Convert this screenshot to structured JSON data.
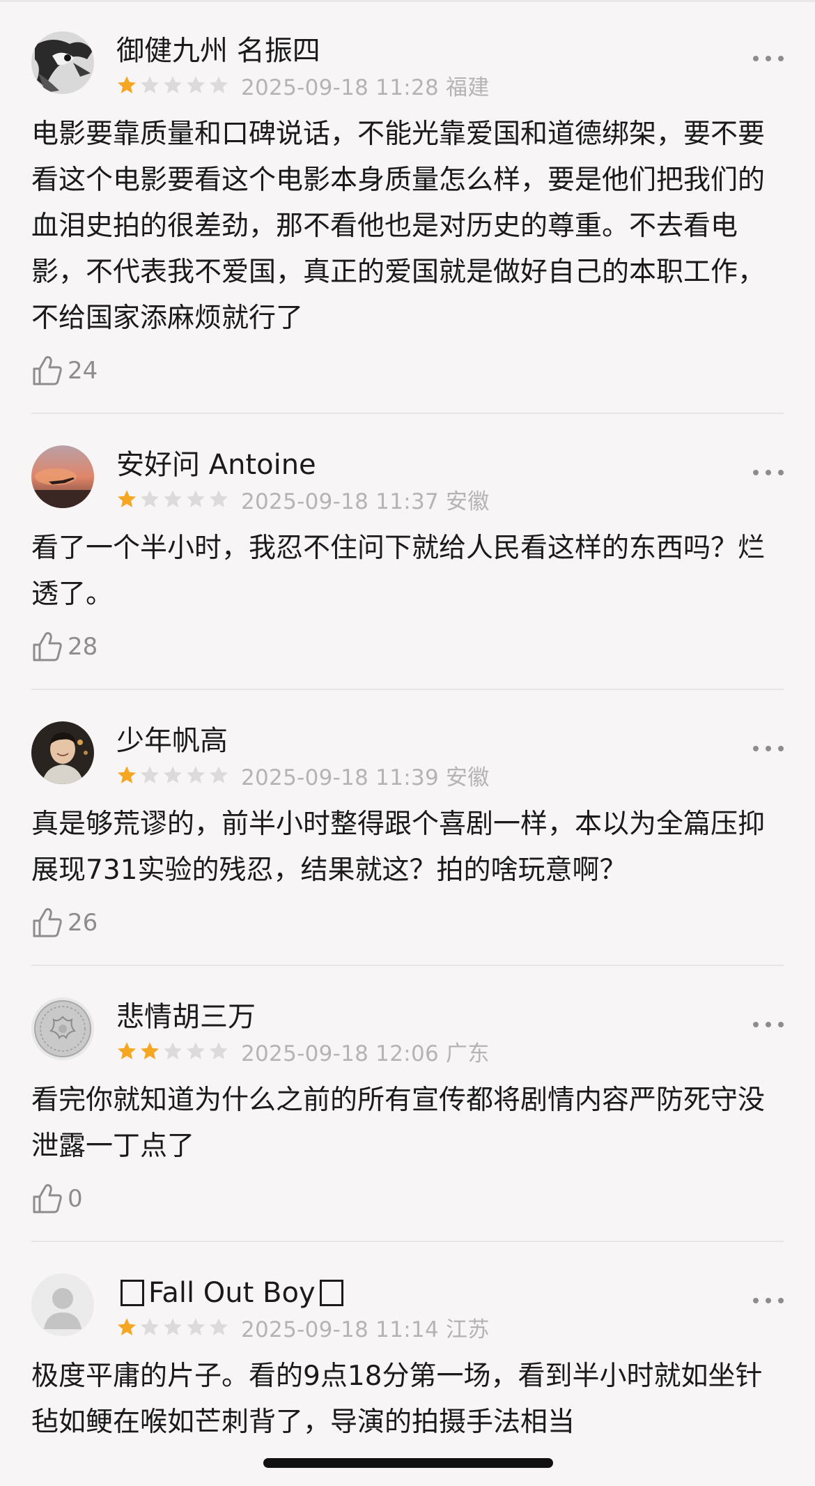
{
  "reviews": [
    {
      "username": "御健九州 名振四",
      "rating": 1,
      "date": "2025-09-18",
      "time": "11:28",
      "location": "福建",
      "content": "电影要靠质量和口碑说话，不能光靠爱国和道德绑架，要不要看这个电影要看这个电影本身质量怎么样，要是他们把我们的血泪史拍的很差劲，那不看他也是对历史的尊重。不去看电影，不代表我不爱国，真正的爱国就是做好自己的本职工作，不给国家添麻烦就行了",
      "likes": "24",
      "avatar": "hawk-drawing-avatar"
    },
    {
      "username": "安好问 Antoine",
      "rating": 1,
      "date": "2025-09-18",
      "time": "11:37",
      "location": "安徽",
      "content": "看了一个半小时，我忍不住问下就给人民看这样的东西吗？烂透了。",
      "likes": "28",
      "avatar": "sunset-plane-avatar"
    },
    {
      "username": "少年帆高",
      "rating": 1,
      "date": "2025-09-18",
      "time": "11:39",
      "location": "安徽",
      "content": "真是够荒谬的，前半小时整得跟个喜剧一样，本以为全篇压抑展现731实验的残忍，结果就这？拍的啥玩意啊？",
      "likes": "26",
      "avatar": "person-photo-avatar"
    },
    {
      "username": "悲情胡三万",
      "rating": 2,
      "date": "2025-09-18",
      "time": "12:06",
      "location": "广东",
      "content": "看完你就知道为什么之前的所有宣传都将剧情内容严防死守没泄露一丁点了",
      "likes": "0",
      "avatar": "coin-avatar"
    },
    {
      "username": "Fall Out Boy",
      "rating": 1,
      "date": "2025-09-18",
      "time": "11:14",
      "location": "江苏",
      "content": "极度平庸的片子。看的9点18分第一场，看到半小时就如坐针毡如鲠在喉如芒刺背了，导演的拍摄手法相当",
      "likes": "",
      "avatar": "default-avatar"
    }
  ],
  "colors": {
    "star_active": "#f5a623",
    "star_inactive": "#dcdadb",
    "meta_text": "#b5b3b4",
    "background": "#f7f5f6"
  },
  "icons": {
    "more": "more-dots-icon",
    "like": "thumbs-up-icon",
    "star": "star-icon"
  }
}
